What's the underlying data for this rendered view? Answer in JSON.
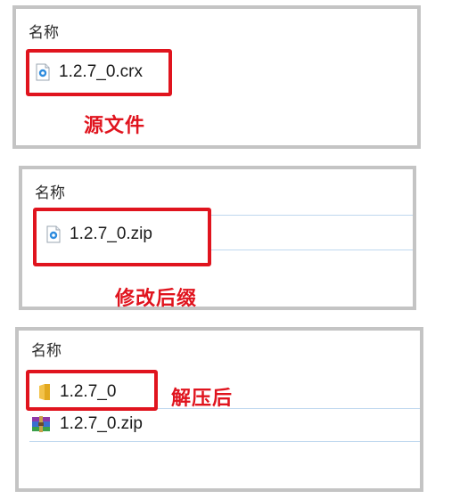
{
  "panels": [
    {
      "column_header": "名称",
      "files": [
        {
          "name": "1.2.7_0.crx",
          "icon": "chrome-extension-file-icon"
        }
      ],
      "caption": "源文件"
    },
    {
      "column_header": "名称",
      "files": [
        {
          "name": "1.2.7_0.zip",
          "icon": "chrome-extension-file-icon"
        }
      ],
      "caption": "修改后缀"
    },
    {
      "column_header": "名称",
      "files": [
        {
          "name": "1.2.7_0",
          "icon": "folder-icon"
        },
        {
          "name": "1.2.7_0.zip",
          "icon": "winrar-archive-icon"
        }
      ],
      "caption": "解压后"
    }
  ],
  "colors": {
    "highlight_red": "#e0141e",
    "panel_border": "#c4c4c4",
    "row_divider": "#bfd8ef",
    "folder_yellow": "#f3c24a"
  }
}
